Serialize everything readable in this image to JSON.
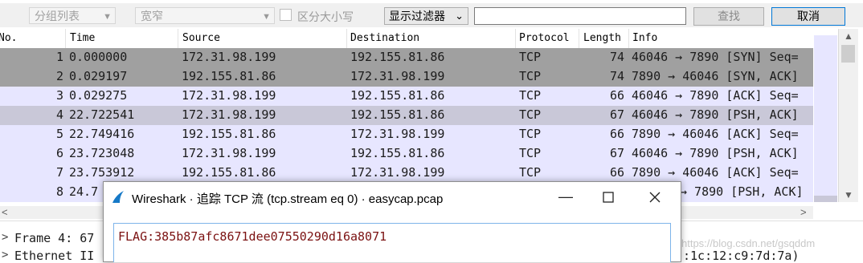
{
  "toolbar": {
    "group_list": "分组列表",
    "width_select": "宽窄",
    "case_label": "区分大小写",
    "filter_dropdown": "显示过滤器",
    "search_value": "",
    "find_button": "查找",
    "cancel_button": "取消"
  },
  "packet_list": {
    "columns": [
      "No.",
      "Time",
      "Source",
      "Destination",
      "Protocol",
      "Length",
      "Info"
    ],
    "rows": [
      {
        "no": "1",
        "time": "0.000000",
        "src": "172.31.98.199",
        "dst": "192.155.81.86",
        "proto": "TCP",
        "len": "74",
        "info": "46046 → 7890 [SYN] Seq="
      },
      {
        "no": "2",
        "time": "0.029197",
        "src": "192.155.81.86",
        "dst": "172.31.98.199",
        "proto": "TCP",
        "len": "74",
        "info": "7890 → 46046 [SYN, ACK]"
      },
      {
        "no": "3",
        "time": "0.029275",
        "src": "172.31.98.199",
        "dst": "192.155.81.86",
        "proto": "TCP",
        "len": "66",
        "info": "46046 → 7890 [ACK] Seq="
      },
      {
        "no": "4",
        "time": "22.722541",
        "src": "172.31.98.199",
        "dst": "192.155.81.86",
        "proto": "TCP",
        "len": "67",
        "info": "46046 → 7890 [PSH, ACK]"
      },
      {
        "no": "5",
        "time": "22.749416",
        "src": "192.155.81.86",
        "dst": "172.31.98.199",
        "proto": "TCP",
        "len": "66",
        "info": "7890 → 46046 [ACK] Seq="
      },
      {
        "no": "6",
        "time": "23.723048",
        "src": "172.31.98.199",
        "dst": "192.155.81.86",
        "proto": "TCP",
        "len": "67",
        "info": "46046 → 7890 [PSH, ACK]"
      },
      {
        "no": "7",
        "time": "23.753912",
        "src": "192.155.81.86",
        "dst": "172.31.98.199",
        "proto": "TCP",
        "len": "66",
        "info": "7890 → 46046 [ACK] Seq="
      },
      {
        "no": "8",
        "time": "24.7",
        "src": "",
        "dst": "",
        "proto": "",
        "len": "",
        "info": "→ 7890 [PSH, ACK]"
      }
    ]
  },
  "details": {
    "line1_prefix": "Frame 4: 67",
    "line2_prefix": "Ethernet II",
    "line2_suffix": ":1c:12:c9:7d:7a)"
  },
  "dialog": {
    "title": "Wireshark · 追踪 TCP 流 (tcp.stream eq 0) · easycap.pcap",
    "content": "FLAG:385b87afc8671dee07550290d16a8071"
  },
  "watermark": "https://blog.csdn.net/gsqddm",
  "colors": {
    "row_selected_dark": "#a0a0a0",
    "row_tcp": "#e7e6ff",
    "row_selected_light": "#c9c8d8",
    "flag_text": "#7b1111"
  }
}
